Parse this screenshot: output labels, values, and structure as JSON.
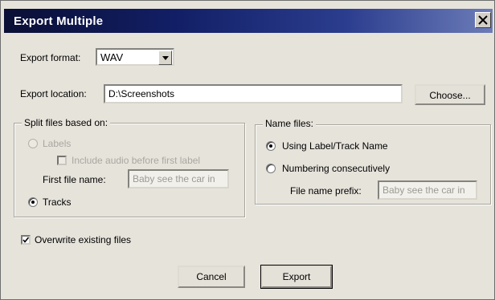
{
  "window": {
    "title": "Export Multiple"
  },
  "export_format": {
    "label": "Export format:",
    "value": "WAV"
  },
  "export_location": {
    "label": "Export location:",
    "value": "D:\\Screenshots",
    "choose_label": "Choose..."
  },
  "split_group": {
    "caption": "Split files based on:",
    "labels_option": "Labels",
    "include_audio_label": "Include audio before first label",
    "first_file_name_label": "First file name:",
    "first_file_name_value": "Baby see the car in",
    "tracks_option": "Tracks",
    "selected": "Tracks"
  },
  "name_group": {
    "caption": "Name files:",
    "using_label_option": "Using Label/Track Name",
    "numbering_option": "Numbering consecutively",
    "prefix_label": "File name prefix:",
    "prefix_value": "Baby see the car in",
    "selected": "Using Label/Track Name"
  },
  "overwrite": {
    "label": "Overwrite existing files",
    "checked": true
  },
  "buttons": {
    "cancel": "Cancel",
    "export": "Export"
  }
}
